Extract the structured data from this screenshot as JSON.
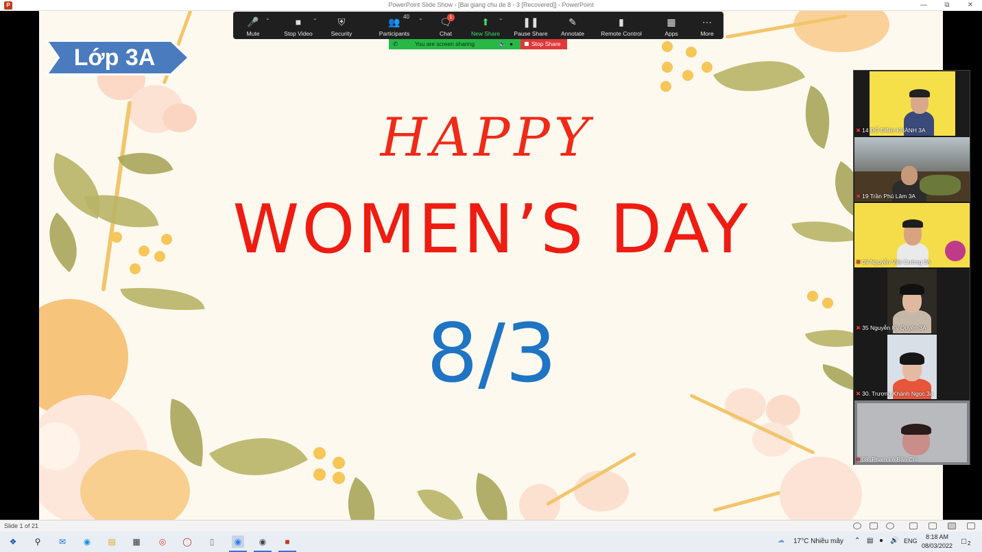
{
  "window": {
    "title": "PowerPoint Slide Show - [Bai giang chu de 8 - 3 [Recovered]] - PowerPoint",
    "app_icon": "P"
  },
  "slide": {
    "badge": "Lớp 3A",
    "line1": "HAPPY",
    "line2": "WOMEN’S DAY",
    "line3": "8/3"
  },
  "zoom_toolbar": {
    "mute": "Mute",
    "stop_video": "Stop Video",
    "security": "Security",
    "participants": "Participants",
    "participants_count": "40",
    "chat": "Chat",
    "chat_badge": "1",
    "new_share": "New Share",
    "pause_share": "Pause Share",
    "annotate": "Annotate",
    "remote_control": "Remote Control",
    "apps": "Apps",
    "more": "More"
  },
  "share_status": {
    "sharing_text": "You are screen sharing",
    "stop_share": "Stop Share"
  },
  "participants": [
    {
      "name": "14 ĐỖ ĐÌNH KHÁNH 3A"
    },
    {
      "name": "19 Trần Phú Lâm 3A"
    },
    {
      "name": "09 Nguyễn Việt Cường 3A"
    },
    {
      "name": "35 Nguyễn Kỳ Quyên 3A"
    },
    {
      "name": "30. Trương Khánh Ngọc.3a"
    },
    {
      "name": "08. Phạm Lê Bảo Chi"
    }
  ],
  "statusbar": {
    "slide_count": "Slide 1 of 21"
  },
  "taskbar": {
    "weather": "17°C  Nhiều mây",
    "language": "ENG",
    "time": "8:18 AM",
    "date": "08/03/2022",
    "notification_count": "2"
  },
  "colors": {
    "slide_bg": "#fdf9ef",
    "happy_red": "#ef2a17",
    "date_blue": "#1f74c4",
    "badge_blue": "#4a7bbf",
    "zoom_bar": "#1f1f1f",
    "share_green": "#28b846",
    "stop_red": "#e0383a"
  }
}
